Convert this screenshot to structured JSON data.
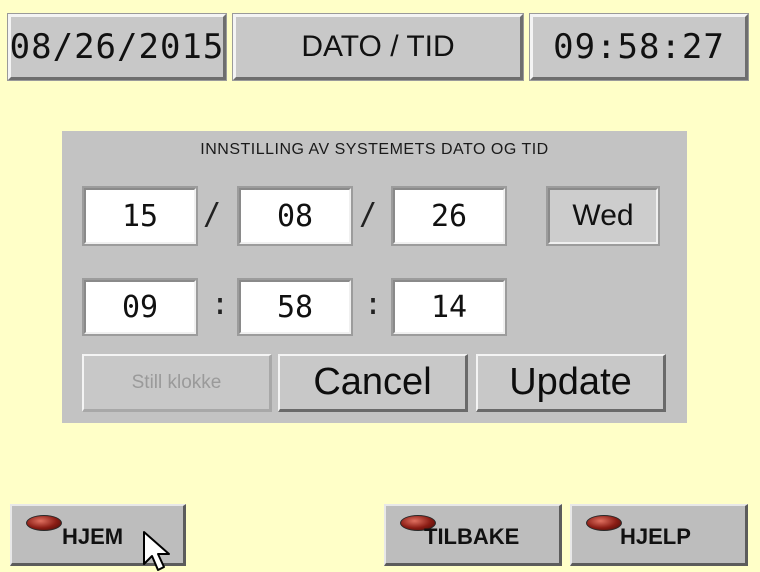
{
  "header": {
    "date": "08/26/2015",
    "title": "DATO / TID",
    "time": "09:58:27"
  },
  "settings": {
    "title": "INNSTILLING AV SYSTEMETS DATO OG TID",
    "date_fields": [
      "15",
      "08",
      "26"
    ],
    "date_separator": "/",
    "weekday": "Wed",
    "time_fields": [
      "09",
      "58",
      "14"
    ],
    "time_separator": ":",
    "buttons": {
      "set_clock": "Still klokke",
      "cancel": "Cancel",
      "update": "Update"
    }
  },
  "nav": {
    "home": "HJEM",
    "back": "TILBAKE",
    "help": "HJELP"
  },
  "colors": {
    "background": "#ffffc8",
    "panel": "#c3c3c3",
    "indicator": "#8a1c14"
  },
  "icons": {
    "indicator": "red-lamp-icon",
    "pointer": "mouse-pointer-icon"
  }
}
